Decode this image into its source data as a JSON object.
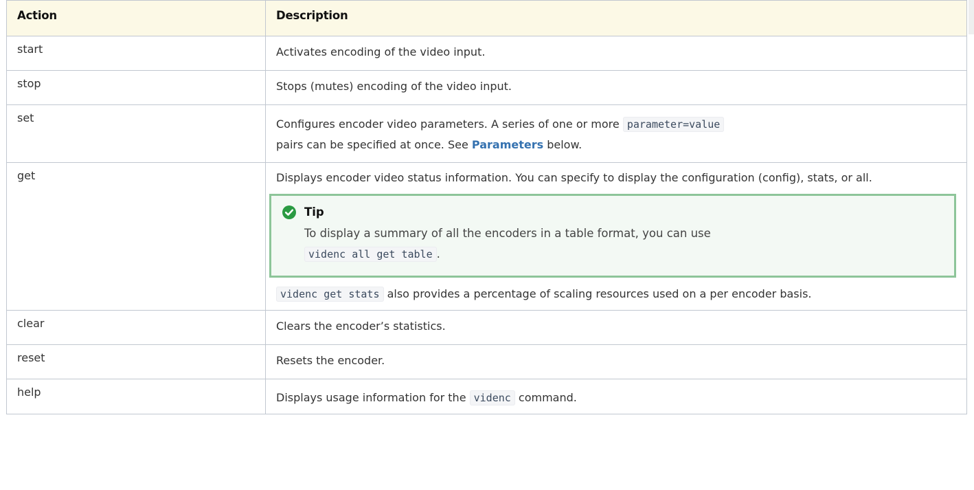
{
  "table": {
    "headers": {
      "action": "Action",
      "description": "Description"
    },
    "rows": [
      {
        "action": "start",
        "description": "Activates encoding of the video input."
      },
      {
        "action": "stop",
        "description": "Stops (mutes) encoding of the video input."
      },
      {
        "action": "set",
        "desc_part1": "Configures encoder video parameters. A series of one or more ",
        "code": "parameter=value",
        "desc_part2": "pairs can be specified at once. See ",
        "link": "Parameters",
        "desc_part3": " below."
      },
      {
        "action": "get",
        "description": "Displays encoder video status information. You can specify to display the configuration (config), stats, or all.",
        "tip": {
          "title": "Tip",
          "text": "To display a summary of all the encoders in a table format, you can use",
          "code": "videnc all get table",
          "end": "."
        },
        "after_code": "videnc get stats",
        "after_text": " also provides a percentage of scaling resources used on a per encoder basis."
      },
      {
        "action": "clear",
        "description": "Clears the encoder’s statistics."
      },
      {
        "action": "reset",
        "description": "Resets the encoder."
      },
      {
        "action": "help",
        "desc_part1": "Displays usage information for the ",
        "code": "videnc",
        "desc_part2": " command."
      }
    ]
  },
  "colors": {
    "header_bg": "#fcf9e6",
    "tip_border": "#8dc599",
    "tip_bg": "#f3f9f4",
    "link": "#3572b0",
    "check_icon": "#2a9a42"
  },
  "icons": {
    "tip": "check-circle-icon"
  }
}
